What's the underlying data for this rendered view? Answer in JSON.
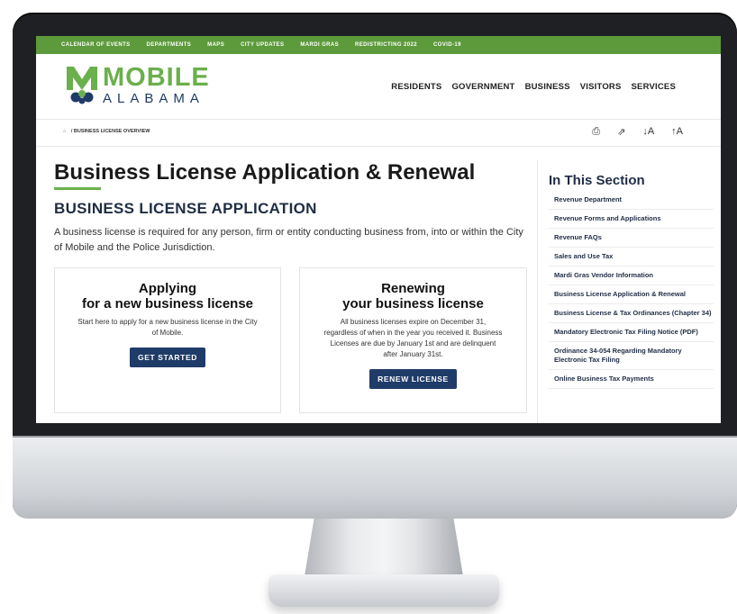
{
  "topbar": {
    "links": [
      "CALENDAR OF EVENTS",
      "DEPARTMENTS",
      "MAPS",
      "CITY UPDATES",
      "MARDI GRAS",
      "REDISTRICTING 2022",
      "COVID-19"
    ]
  },
  "logo": {
    "word1": "MOBILE",
    "word2": "ALABAMA"
  },
  "mainnav": {
    "items": [
      "RESIDENTS",
      "GOVERNMENT",
      "BUSINESS",
      "VISITORS",
      "SERVICES"
    ]
  },
  "breadcrumb": {
    "home_icon": "home-icon",
    "separator": "/",
    "current": "BUSINESS LICENSE OVERVIEW"
  },
  "tools": {
    "print": "⎙",
    "share": "⇗",
    "decrease": "↓A",
    "increase": "↑A"
  },
  "page": {
    "title": "Business License Application & Renewal",
    "subtitle": "BUSINESS LICENSE APPLICATION",
    "intro": "A business license is required for any person, firm or entity conducting business from, into or within the City of Mobile and the Police Jurisdiction."
  },
  "cards": [
    {
      "title_line1": "Applying",
      "title_line2": "for a new business license",
      "body": "Start here to apply for a new business license in the City of Mobile.",
      "button": "GET STARTED"
    },
    {
      "title_line1": "Renewing",
      "title_line2": "your business license",
      "body": "All business licenses expire on December 31, regardless of when in the year you received it. Business Licenses are due by January 1st and are delinquent after January 31st.",
      "button": "RENEW LICENSE"
    }
  ],
  "sidebar": {
    "title": "In This Section",
    "items": [
      "Revenue Department",
      "Revenue Forms and Applications",
      "Revenue FAQs",
      "Sales and Use Tax",
      "Mardi Gras Vendor Information",
      "Business License Application & Renewal",
      "Business License & Tax Ordinances (Chapter 34)",
      "Mandatory Electronic Tax Filing Notice (PDF)",
      "Ordinance 34-054 Regarding Mandatory Electronic Tax Filing",
      "Online Business Tax Payments"
    ]
  },
  "colors": {
    "green": "#5d9a3b",
    "navy": "#1f3b68"
  }
}
